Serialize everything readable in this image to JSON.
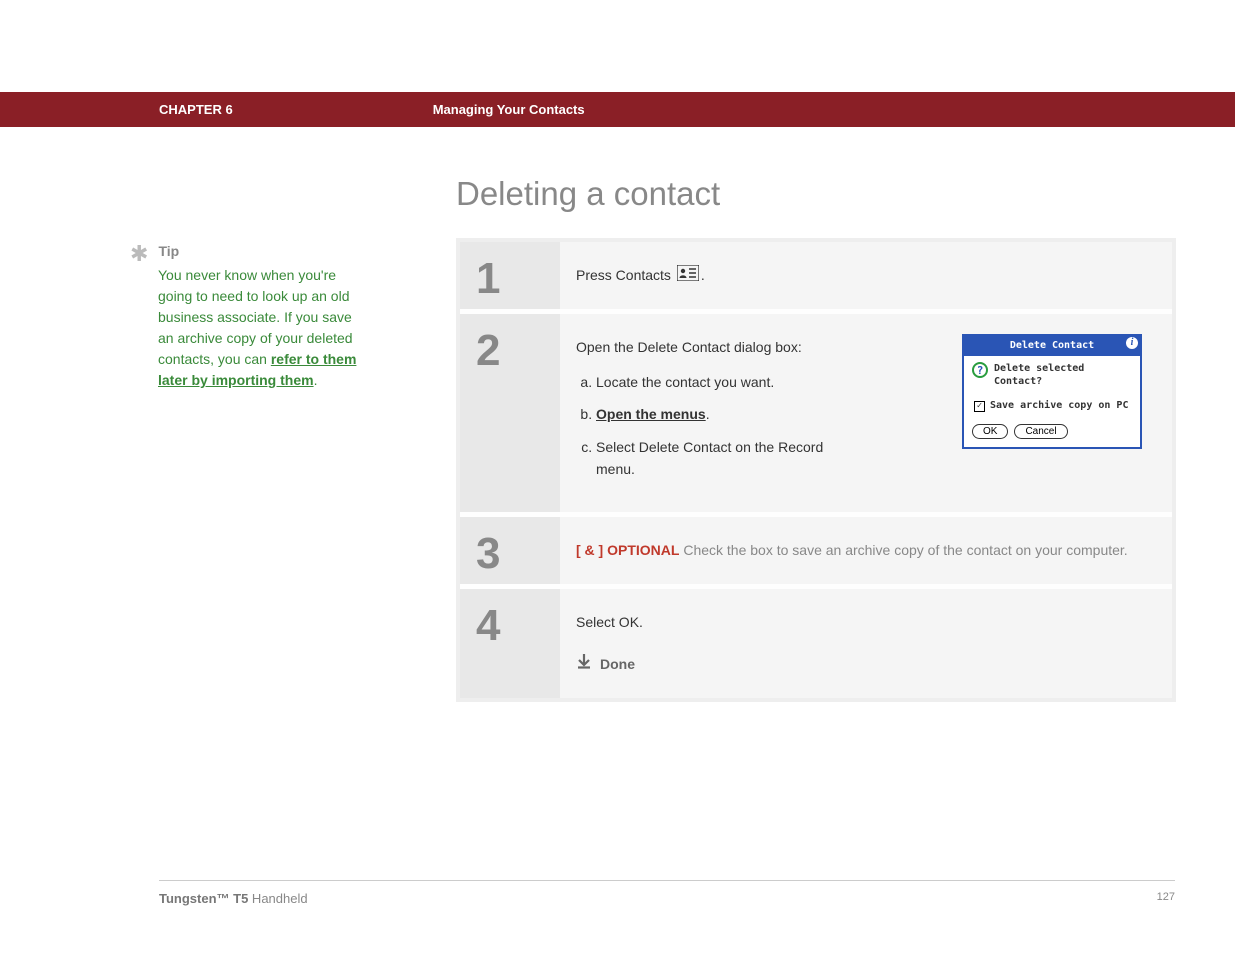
{
  "header": {
    "chapter": "CHAPTER 6",
    "section": "Managing Your Contacts"
  },
  "title": "Deleting a contact",
  "sidebar": {
    "tip_label": "Tip",
    "tip_text": "You never know when you're going to need to look up an old business associate. If you save an archive copy of your deleted contacts, you can ",
    "tip_link": "refer to them later by importing them",
    "tip_after": "."
  },
  "steps": {
    "s1": {
      "num": "1",
      "text_before": "Press Contacts ",
      "text_after": "."
    },
    "s2": {
      "num": "2",
      "intro": "Open the Delete Contact dialog box:",
      "a": "Locate the contact you want.",
      "b_link": "Open the menus",
      "b_after": ".",
      "c": "Select Delete Contact on the Record menu."
    },
    "s3": {
      "num": "3",
      "optional_label": "[ & ]  OPTIONAL",
      "optional_text": "   Check the box to save an archive copy of the contact on your computer."
    },
    "s4": {
      "num": "4",
      "text": "Select OK.",
      "done": "Done"
    }
  },
  "dialog": {
    "title": "Delete Contact",
    "question": "Delete selected Contact?",
    "checkbox": "Save archive copy on PC",
    "ok": "OK",
    "cancel": "Cancel"
  },
  "footer": {
    "product_bold": "Tungsten™ T5",
    "product_rest": " Handheld",
    "page": "127"
  }
}
